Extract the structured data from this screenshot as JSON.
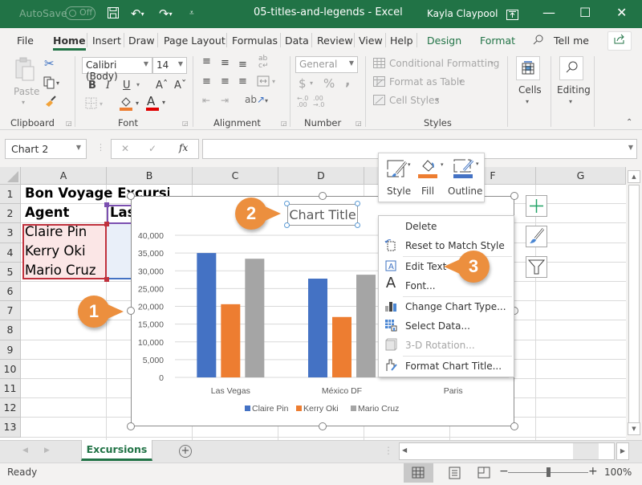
{
  "titlebar": {
    "autosave_label": "AutoSave",
    "autosave_state": "Off",
    "document_title": "05-titles-and-legends  -  Excel",
    "user_name": "Kayla Claypool",
    "minimize": "—",
    "maximize": "☐",
    "close": "✕"
  },
  "menu": {
    "tabs": [
      "File",
      "Home",
      "Insert",
      "Draw",
      "Page Layout",
      "Formulas",
      "Data",
      "Review",
      "View",
      "Help",
      "Design",
      "Format"
    ],
    "active_tab": "Home",
    "tell_me": "Tell me"
  },
  "ribbon": {
    "clipboard": {
      "paste": "Paste",
      "label": "Clipboard"
    },
    "font": {
      "name": "Calibri (Body)",
      "size": "14",
      "bold": "B",
      "italic": "I",
      "underline": "U",
      "grow": "Aˆ",
      "shrink": "Aˇ",
      "label": "Font",
      "fill_color": "#ed7d31",
      "font_color": "#e00000"
    },
    "alignment": {
      "label": "Alignment"
    },
    "number": {
      "format": "General",
      "currency": "$",
      "percent": "%",
      "comma": ",",
      "label": "Number"
    },
    "styles": {
      "conditional": "Conditional Formatting",
      "format_table": "Format as Table",
      "cell_styles": "Cell Styles",
      "label": "Styles"
    },
    "cells": {
      "label": "Cells"
    },
    "editing": {
      "label": "Editing"
    }
  },
  "formula_bar": {
    "name_box": "Chart 2",
    "cancel": "✕",
    "enter": "✓",
    "fx": "fx",
    "value": ""
  },
  "sheet": {
    "columns": [
      "A",
      "B",
      "C",
      "D",
      "E",
      "F",
      "G"
    ],
    "rows": [
      "1",
      "2",
      "3",
      "4",
      "5",
      "6",
      "7",
      "8",
      "9",
      "10",
      "11",
      "12",
      "13"
    ],
    "cells": {
      "A1": "Bon Voyage Excursions",
      "A2": "Agent",
      "B2": "Las",
      "A3": "Claire Pin",
      "A4": "Kerry Oki",
      "A5": "Mario Cruz"
    }
  },
  "chart_data": {
    "type": "bar",
    "title": "Chart Title",
    "categories": [
      "Las Vegas",
      "México DF",
      "Paris"
    ],
    "series": [
      {
        "name": "Claire Pin",
        "color": "#4472c4",
        "values": [
          35000,
          27800,
          null
        ]
      },
      {
        "name": "Kerry Oki",
        "color": "#ed7d31",
        "values": [
          20600,
          17000,
          null
        ]
      },
      {
        "name": "Mario Cruz",
        "color": "#a5a5a5",
        "values": [
          33400,
          28900,
          null
        ]
      }
    ],
    "yticks": [
      "0",
      "5,000",
      "10,000",
      "15,000",
      "20,000",
      "25,000",
      "30,000",
      "35,000",
      "40,000"
    ],
    "ylim": [
      0,
      40000
    ],
    "grid": true,
    "legend": "bottom",
    "xlabel": "",
    "ylabel": ""
  },
  "mini_toolbar": {
    "style": "Style",
    "fill": "Fill",
    "outline": "Outline"
  },
  "context_menu": {
    "items": [
      {
        "label": "Delete",
        "icon": "",
        "disabled": false
      },
      {
        "label": "Reset to Match Style",
        "icon": "reset-style-icon",
        "disabled": false
      },
      {
        "label": "Edit Text",
        "icon": "edit-text-icon",
        "disabled": false
      },
      {
        "label": "Font...",
        "icon": "font-icon",
        "disabled": false
      },
      {
        "label": "Change Chart Type...",
        "icon": "chart-type-icon",
        "disabled": false
      },
      {
        "label": "Select Data...",
        "icon": "select-data-icon",
        "disabled": false
      },
      {
        "label": "3-D Rotation...",
        "icon": "3d-rotation-icon",
        "disabled": true
      },
      {
        "label": "Format Chart Title...",
        "icon": "format-title-icon",
        "disabled": false
      }
    ]
  },
  "callouts": [
    "1",
    "2",
    "3"
  ],
  "sheet_tabs": {
    "active": "Excursions",
    "add": "+"
  },
  "status": {
    "ready": "Ready",
    "zoom": "100%",
    "zoom_fraction": 0.5
  }
}
